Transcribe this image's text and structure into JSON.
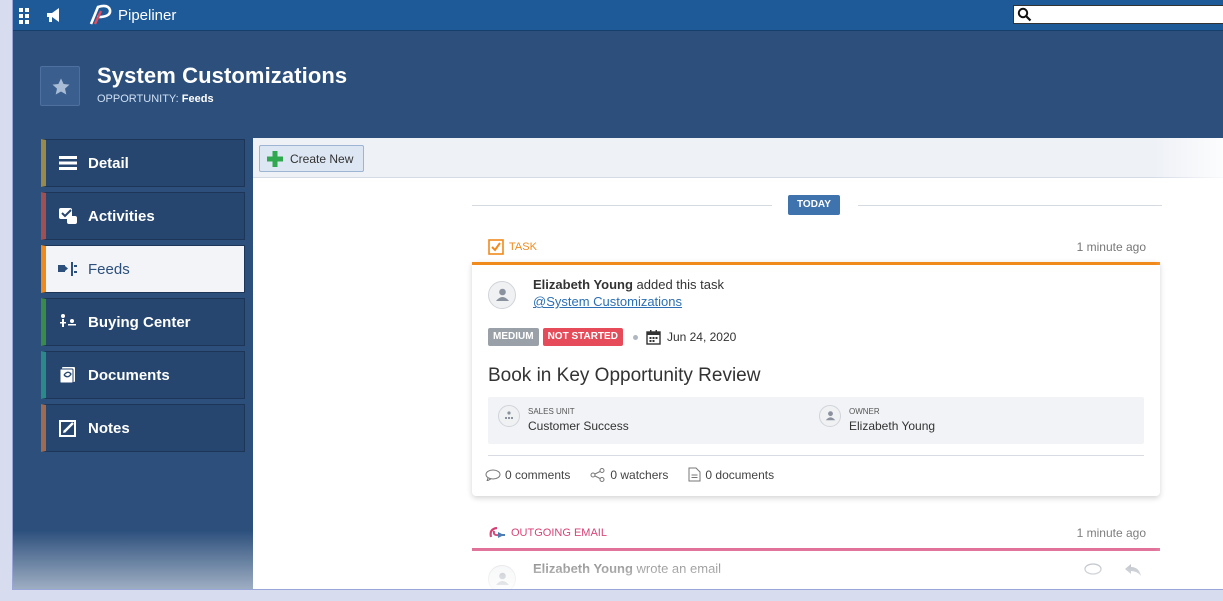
{
  "app": {
    "logo_text": "Pipeliner"
  },
  "header": {
    "title": "System Customizations",
    "subtitle_prefix": "OPPORTUNITY: ",
    "subtitle_value": "Feeds"
  },
  "sidebar": {
    "items": [
      {
        "label": "Detail",
        "icon": "detail-icon",
        "color": "#9a8a4a"
      },
      {
        "label": "Activities",
        "icon": "activities-icon",
        "color": "#a05050"
      },
      {
        "label": "Feeds",
        "icon": "feeds-icon",
        "color": "#f08a1d"
      },
      {
        "label": "Buying Center",
        "icon": "buying-center-icon",
        "color": "#3a8a4a"
      },
      {
        "label": "Documents",
        "icon": "documents-icon",
        "color": "#2a8a8a"
      },
      {
        "label": "Notes",
        "icon": "notes-icon",
        "color": "#a06a50"
      }
    ]
  },
  "toolbar": {
    "create_label": "Create New"
  },
  "feed": {
    "day_label": "TODAY",
    "task": {
      "type_label": "TASK",
      "time": "1 minute ago",
      "author": "Elizabeth Young",
      "action": " added this task",
      "mention": "@System Customizations",
      "priority": "MEDIUM",
      "status": "NOT STARTED",
      "date": "Jun 24, 2020",
      "title": "Book in Key Opportunity Review",
      "sales_unit_caption": "SALES UNIT",
      "sales_unit_value": "Customer Success",
      "owner_caption": "OWNER",
      "owner_value": "Elizabeth Young",
      "comments": "0 comments",
      "watchers": "0 watchers",
      "documents": "0 documents"
    },
    "email": {
      "type_label": "OUTGOING EMAIL",
      "time": "1 minute ago",
      "author": "Elizabeth Young",
      "action": " wrote an email"
    }
  },
  "colors": {
    "task_accent": "#f08a1d",
    "email_accent": "#d63d73",
    "priority_tag": "#9aa0a8",
    "status_tag": "#e64b5a"
  }
}
